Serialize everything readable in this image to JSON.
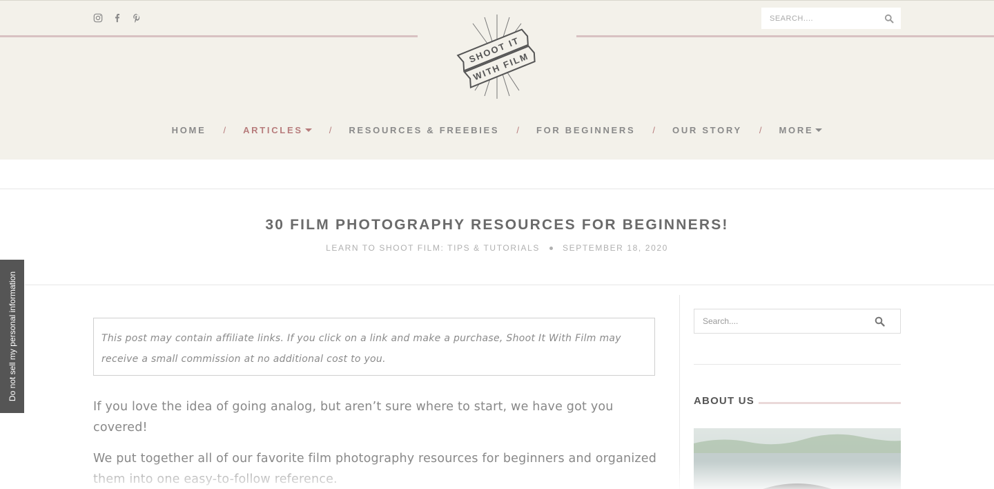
{
  "header": {
    "social_icons": [
      "instagram-icon",
      "facebook-icon",
      "pinterest-icon"
    ],
    "search_placeholder": "SEARCH....",
    "logo_text_line1": "SHOOT IT",
    "logo_text_line2": "WITH FILM"
  },
  "nav": {
    "items": [
      {
        "label": "HOME"
      },
      {
        "label": "ARTICLES"
      },
      {
        "label": "RESOURCES & FREEBIES"
      },
      {
        "label": "FOR BEGINNERS"
      },
      {
        "label": "OUR STORY"
      },
      {
        "label": "MORE"
      }
    ],
    "separator": "/",
    "active_item": "ARTICLES"
  },
  "post": {
    "title": "30 FILM PHOTOGRAPHY RESOURCES FOR BEGINNERS!",
    "category": "LEARN TO SHOOT FILM: TIPS & TUTORIALS",
    "date": "SEPTEMBER 18, 2020",
    "affiliate_notice": "This post may contain affiliate links. If you click on a link and make a purchase, Shoot It With Film may receive a small commission at no additional cost to you.",
    "paragraph1": "If you love the idea of going analog, but aren’t sure where to start, we have got you covered!",
    "paragraph2": "We put together all of our favorite film photography resources for beginners and organized them into one easy-to-follow reference."
  },
  "sidebar": {
    "search_placeholder": "Search....",
    "about_title": "ABOUT US"
  },
  "privacy_tab": {
    "label": "Do not sell my personal information"
  },
  "colors": {
    "header_bg": "#f3f1ea",
    "accent": "#b77c7c",
    "rule": "#d8c2c2"
  }
}
